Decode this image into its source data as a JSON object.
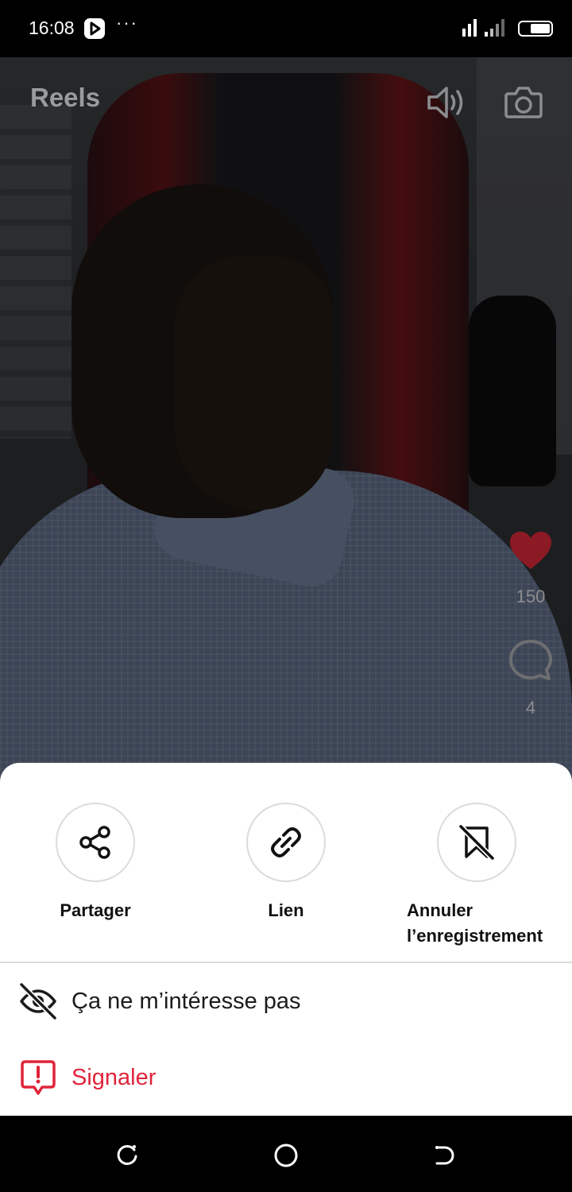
{
  "status_bar": {
    "time": "16:08",
    "dots": "···",
    "icons": [
      "play-app-icon",
      "signal-icon",
      "battery-icon"
    ]
  },
  "header": {
    "title": "Reels",
    "icons": [
      "speaker-icon",
      "camera-icon"
    ]
  },
  "reel": {
    "like_count": "150",
    "comment_count": "4",
    "icons": [
      "heart-icon",
      "comment-icon"
    ],
    "like_color": "#e0243a"
  },
  "sheet": {
    "actions": [
      {
        "label": "Partager",
        "icon": "share-icon"
      },
      {
        "label": "Lien",
        "icon": "link-icon"
      },
      {
        "label_line1": "Annuler",
        "label_line2": "l’enregistrement",
        "icon": "unsave-bookmark-icon"
      }
    ],
    "menu": [
      {
        "label": "Ça ne m’intéresse pas",
        "icon": "eye-off-icon"
      },
      {
        "label": "Signaler",
        "icon": "report-icon",
        "color": "#e0243a"
      }
    ]
  },
  "nav_bar": {
    "icons": [
      "recent-apps-icon",
      "home-icon",
      "back-icon"
    ]
  }
}
